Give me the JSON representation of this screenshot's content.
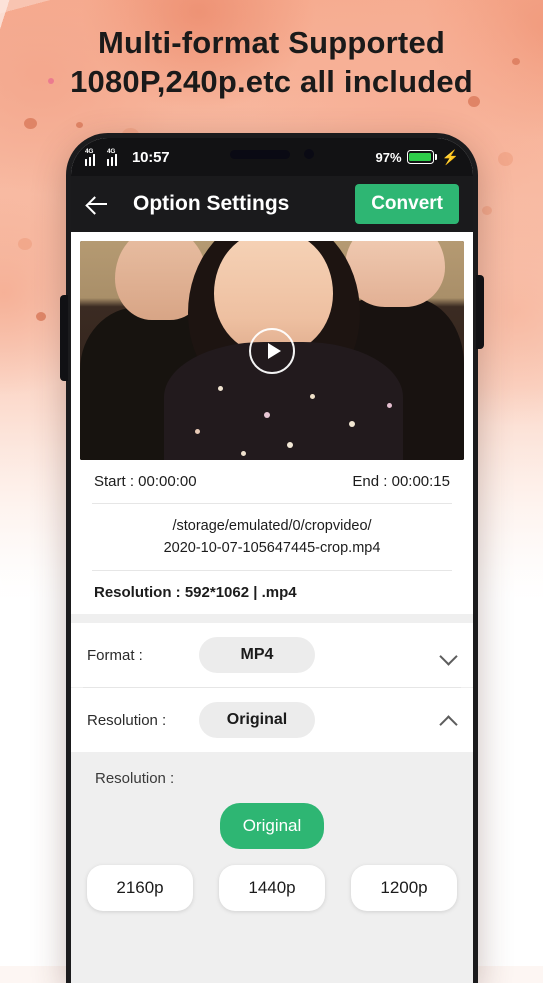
{
  "promo": {
    "line1": "Multi-format Supported",
    "line2": "1080P,240p.etc all included"
  },
  "statusbar": {
    "network_1": "4G",
    "network_2": "4G",
    "time": "10:57",
    "battery_percent": "97%",
    "charging_icon": "charging-bolt-icon"
  },
  "appbar": {
    "back_icon": "back-arrow-icon",
    "title": "Option Settings",
    "convert_label": "Convert",
    "convert_color": "#2eb673"
  },
  "video": {
    "play_icon": "play-circle-icon"
  },
  "file_info": {
    "start_label": "Start : 00:00:00",
    "end_label": "End : 00:00:15",
    "path_line1": "/storage/emulated/0/cropvideo/",
    "path_line2": "2020-10-07-105647445-crop.mp4",
    "resolution_label": "Resolution : 592*1062 | .mp4"
  },
  "options": [
    {
      "label": "Format :",
      "value": "MP4",
      "chevron": "chevron-down-icon"
    },
    {
      "label": "Resolution :",
      "value": "Original",
      "chevron": "chevron-up-icon"
    }
  ],
  "resolution_panel": {
    "title": "Resolution :",
    "selected": "Original",
    "options": [
      "2160p",
      "1440p",
      "1200p"
    ],
    "selected_color": "#2eb673"
  }
}
